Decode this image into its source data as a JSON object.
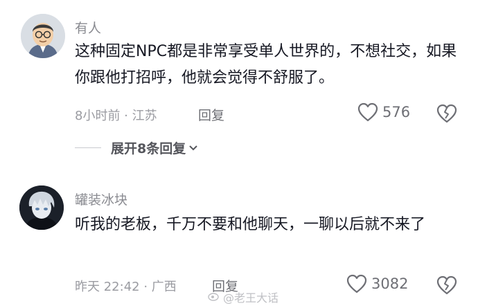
{
  "comments": [
    {
      "username": "有人",
      "content": "这种固定NPC都是非常享受单人世界的，不想社交，如果你跟他打招呼，他就会觉得不舒服了。",
      "meta": "8小时前 · 江苏",
      "reply_label": "回复",
      "likes": "576",
      "avatar_icon": "cartoon-man-avatar"
    },
    {
      "username": "罐装冰块",
      "content": "听我的老板，千万不要和他聊天，一聊以后就不来了",
      "meta": "昨天 22:42 · 广西",
      "reply_label": "回复",
      "likes": "3082",
      "avatar_icon": "anime-boy-avatar"
    }
  ],
  "expand_replies": "展开8条回复",
  "watermark": "@老王大话",
  "colors": {
    "text": "#161823",
    "secondary": "#8a8b91",
    "icon": "#6e6f75"
  }
}
